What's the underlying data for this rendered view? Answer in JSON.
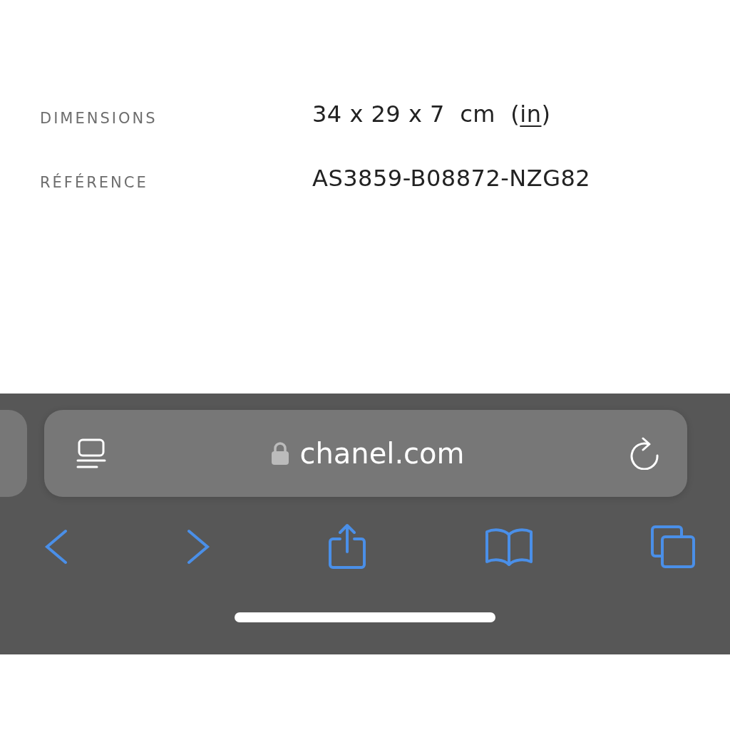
{
  "details": [
    {
      "label": "DIMENSIONS",
      "value": "34 x 29 x 7  cm  (",
      "link": "in",
      "value_after": ")"
    },
    {
      "label": "RÉFÉRENCE",
      "value": "AS3859-B08872-NZG82"
    }
  ],
  "address_bar": {
    "url": "chanel.com",
    "secure": true
  }
}
